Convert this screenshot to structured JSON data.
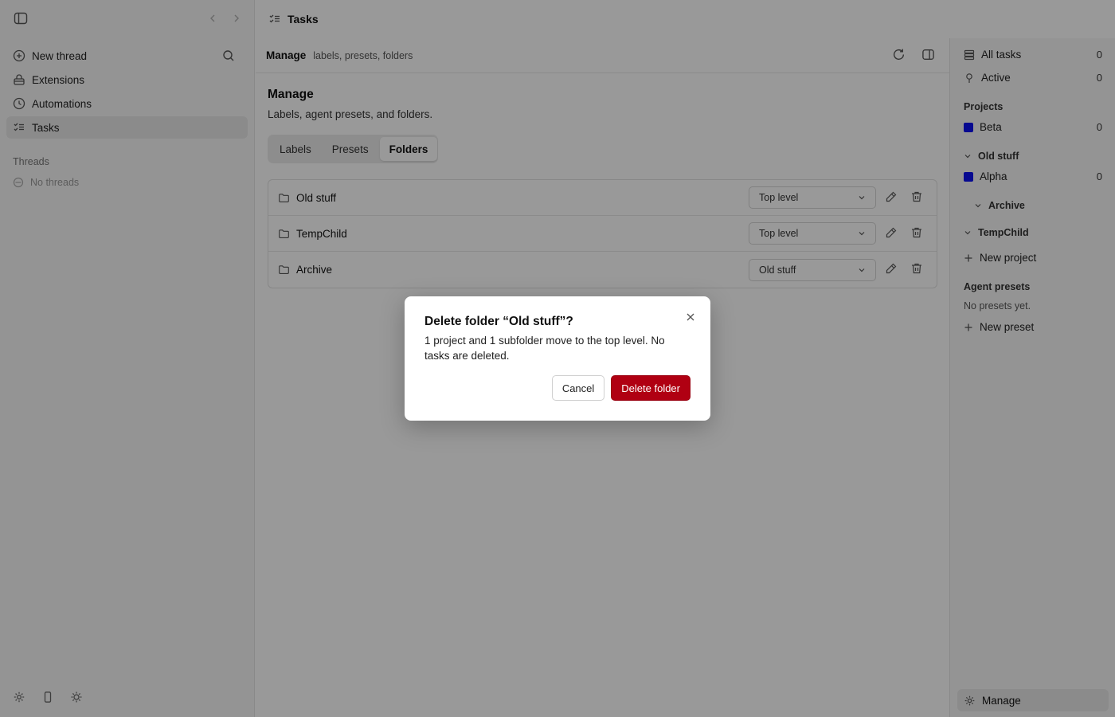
{
  "sidebar": {
    "items": [
      {
        "label": "New thread"
      },
      {
        "label": "Extensions"
      },
      {
        "label": "Automations"
      },
      {
        "label": "Tasks"
      }
    ],
    "threads_heading": "Threads",
    "threads_empty": "No threads"
  },
  "header": {
    "title": "Tasks"
  },
  "main": {
    "head_title": "Manage",
    "head_subtitle": "labels, presets, folders",
    "title": "Manage",
    "subtitle": "Labels, agent presets, and folders.",
    "tabs": [
      {
        "label": "Labels"
      },
      {
        "label": "Presets"
      },
      {
        "label": "Folders",
        "active": true
      }
    ],
    "folders": [
      {
        "name": "Old stuff",
        "parent": "Top level"
      },
      {
        "name": "TempChild",
        "parent": "Top level"
      },
      {
        "name": "Archive",
        "parent": "Old stuff"
      }
    ]
  },
  "right_panel": {
    "all_tasks": {
      "label": "All tasks",
      "count": "0"
    },
    "active": {
      "label": "Active",
      "count": "0"
    },
    "projects_heading": "Projects",
    "beta": {
      "label": "Beta",
      "count": "0"
    },
    "old_stuff": "Old stuff",
    "alpha": {
      "label": "Alpha",
      "count": "0"
    },
    "archive": "Archive",
    "tempchild": "TempChild",
    "new_project": "New project",
    "presets_heading": "Agent presets",
    "presets_empty": "No presets yet.",
    "new_preset": "New preset",
    "manage": "Manage",
    "project_color": "#0a10f0"
  },
  "dialog": {
    "title": "Delete folder “Old stuff”?",
    "message": "1 project and 1 subfolder move to the top level. No tasks are deleted.",
    "cancel": "Cancel",
    "confirm": "Delete folder",
    "danger_color": "#b00012"
  }
}
